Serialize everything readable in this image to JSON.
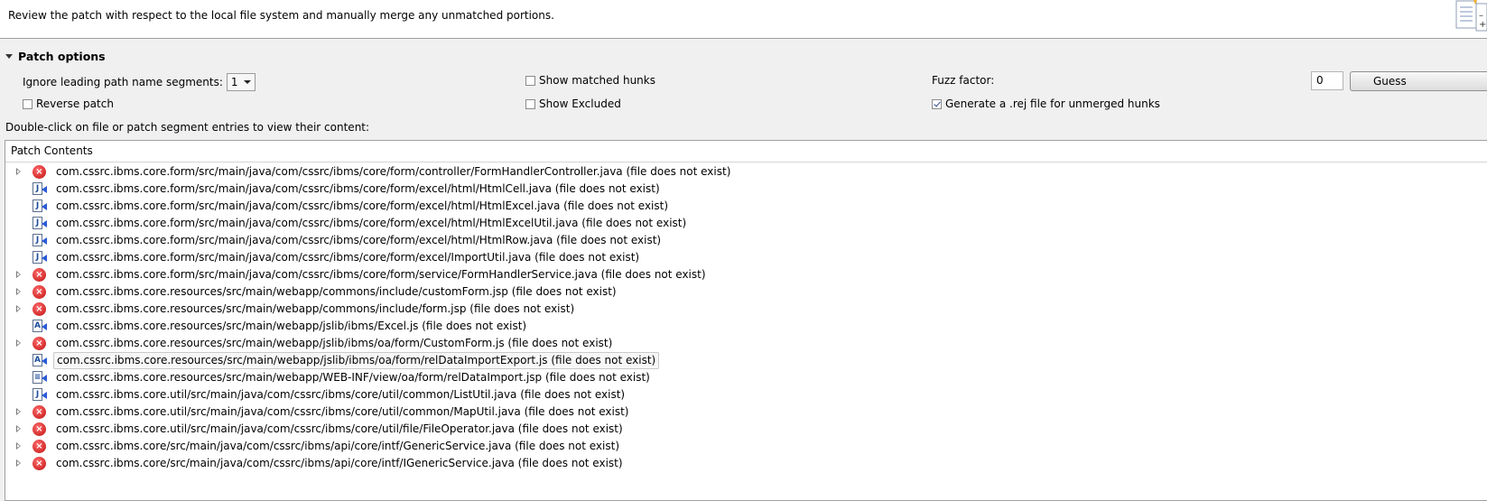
{
  "header": {
    "description": "Review the patch with respect to the local file system and manually merge any unmatched portions."
  },
  "options": {
    "section_title": "Patch options",
    "ignore_label": "Ignore leading path name segments:",
    "ignore_value": "1",
    "reverse_label": "Reverse patch",
    "reverse_checked": false,
    "show_matched_label": "Show matched hunks",
    "show_matched_checked": false,
    "show_excluded_label": "Show Excluded",
    "show_excluded_checked": false,
    "fuzz_label": "Fuzz factor:",
    "fuzz_value": "0",
    "guess_label": "Guess",
    "generate_rej_label": "Generate a .rej file for unmerged hunks",
    "generate_rej_checked": true,
    "double_click_hint": "Double-click on file or patch segment entries to view their content:"
  },
  "tree": {
    "header": "Patch Contents",
    "rows": [
      {
        "label": "com.cssrc.ibms.core.form/src/main/java/com/cssrc/ibms/core/form/controller/FormHandlerController.java (file does not exist)",
        "icon": "error-icon",
        "expandable": true
      },
      {
        "label": "com.cssrc.ibms.core.form/src/main/java/com/cssrc/ibms/core/form/excel/html/HtmlCell.java (file does not exist)",
        "icon": "java-file-icon",
        "expandable": false
      },
      {
        "label": "com.cssrc.ibms.core.form/src/main/java/com/cssrc/ibms/core/form/excel/html/HtmlExcel.java (file does not exist)",
        "icon": "java-file-icon",
        "expandable": false
      },
      {
        "label": "com.cssrc.ibms.core.form/src/main/java/com/cssrc/ibms/core/form/excel/html/HtmlExcelUtil.java (file does not exist)",
        "icon": "java-file-icon",
        "expandable": false
      },
      {
        "label": "com.cssrc.ibms.core.form/src/main/java/com/cssrc/ibms/core/form/excel/html/HtmlRow.java (file does not exist)",
        "icon": "java-file-icon",
        "expandable": false
      },
      {
        "label": "com.cssrc.ibms.core.form/src/main/java/com/cssrc/ibms/core/form/excel/ImportUtil.java (file does not exist)",
        "icon": "java-file-icon",
        "expandable": false
      },
      {
        "label": "com.cssrc.ibms.core.form/src/main/java/com/cssrc/ibms/core/form/service/FormHandlerService.java (file does not exist)",
        "icon": "error-icon",
        "expandable": true
      },
      {
        "label": "com.cssrc.ibms.core.resources/src/main/webapp/commons/include/customForm.jsp (file does not exist)",
        "icon": "error-icon",
        "expandable": true
      },
      {
        "label": "com.cssrc.ibms.core.resources/src/main/webapp/commons/include/form.jsp (file does not exist)",
        "icon": "error-icon",
        "expandable": true
      },
      {
        "label": "com.cssrc.ibms.core.resources/src/main/webapp/jslib/ibms/Excel.js (file does not exist)",
        "icon": "js-file-icon",
        "expandable": false
      },
      {
        "label": "com.cssrc.ibms.core.resources/src/main/webapp/jslib/ibms/oa/form/CustomForm.js (file does not exist)",
        "icon": "error-icon",
        "expandable": true
      },
      {
        "label": "com.cssrc.ibms.core.resources/src/main/webapp/jslib/ibms/oa/form/relDataImportExport.js (file does not exist)",
        "icon": "js-file-icon",
        "expandable": false,
        "selected": true
      },
      {
        "label": "com.cssrc.ibms.core.resources/src/main/webapp/WEB-INF/view/oa/form/relDataImport.jsp (file does not exist)",
        "icon": "jsp-file-icon",
        "expandable": false
      },
      {
        "label": "com.cssrc.ibms.core.util/src/main/java/com/cssrc/ibms/core/util/common/ListUtil.java (file does not exist)",
        "icon": "java-file-icon",
        "expandable": false
      },
      {
        "label": "com.cssrc.ibms.core.util/src/main/java/com/cssrc/ibms/core/util/common/MapUtil.java (file does not exist)",
        "icon": "error-icon",
        "expandable": true
      },
      {
        "label": "com.cssrc.ibms.core.util/src/main/java/com/cssrc/ibms/core/util/file/FileOperator.java (file does not exist)",
        "icon": "error-icon",
        "expandable": true
      },
      {
        "label": "com.cssrc.ibms.core/src/main/java/com/cssrc/ibms/api/core/intf/GenericService.java (file does not exist)",
        "icon": "error-icon",
        "expandable": true
      },
      {
        "label": "com.cssrc.ibms.core/src/main/java/com/cssrc/ibms/api/core/intf/IGenericService.java (file does not exist)",
        "icon": "error-icon",
        "expandable": true
      }
    ]
  }
}
